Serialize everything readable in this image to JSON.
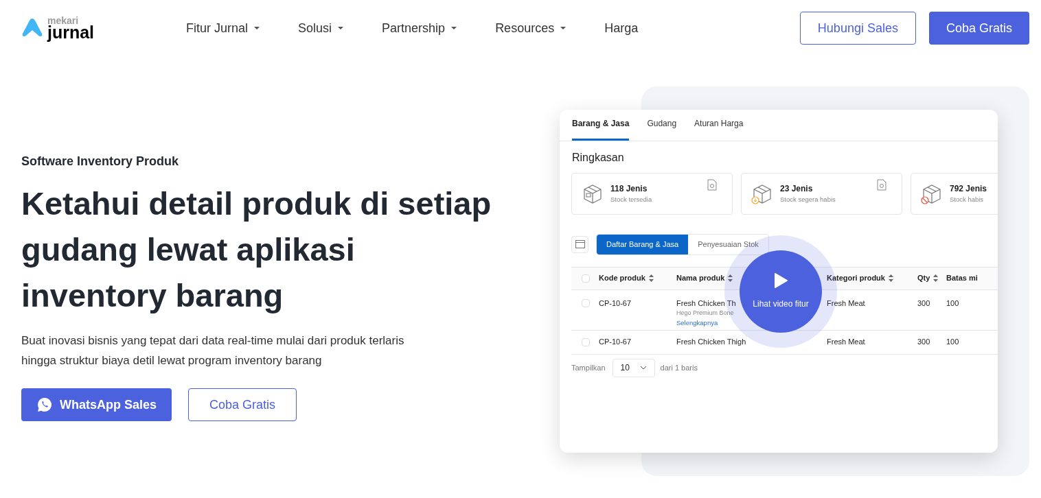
{
  "logo": {
    "brand": "mekari",
    "product": "jurnal"
  },
  "nav": [
    {
      "label": "Fitur Jurnal",
      "has_dropdown": true
    },
    {
      "label": "Solusi",
      "has_dropdown": true
    },
    {
      "label": "Partnership",
      "has_dropdown": true
    },
    {
      "label": "Resources",
      "has_dropdown": true
    },
    {
      "label": "Harga",
      "has_dropdown": false
    }
  ],
  "header_buttons": [
    {
      "label": "Hubungi Sales",
      "kind": "outline"
    },
    {
      "label": "Coba Gratis",
      "kind": "solid"
    }
  ],
  "hero": {
    "eyebrow": "Software Inventory Produk",
    "title_lines": [
      "Ketahui detail produk di setiap",
      "gudang lewat aplikasi",
      "inventory barang"
    ],
    "description_lines": [
      "Buat inovasi bisnis yang tepat dari data real-time mulai dari produk terlaris",
      "hingga struktur biaya detil lewat program inventory barang"
    ],
    "buttons": [
      {
        "label": "WhatsApp Sales",
        "kind": "solid"
      },
      {
        "label": "Coba Gratis",
        "kind": "outline"
      }
    ]
  },
  "mockup": {
    "tabs": [
      {
        "label": "Barang & Jasa",
        "selected": true
      },
      {
        "label": "Gudang",
        "selected": false
      },
      {
        "label": "Aturan Harga",
        "selected": false
      }
    ],
    "summary_title": "Ringkasan",
    "stats": [
      {
        "value": "118 Jenis",
        "label": "Stock tersedia",
        "kind": "available"
      },
      {
        "value": "23 Jenis",
        "label": "Stock segera habis",
        "kind": "low"
      },
      {
        "value": "792 Jenis",
        "label": "Stock habis",
        "kind": "empty"
      }
    ],
    "select_all": {
      "checked": false
    },
    "segments": [
      {
        "label": "Daftar Barang & Jasa",
        "selected": true
      },
      {
        "label": "Penyesuaian Stok",
        "selected": false
      }
    ],
    "columns": [
      "Kode produk",
      "Nama produk",
      "Kategori produk",
      "Qty",
      "Batas mi"
    ],
    "rows": [
      {
        "checked": false,
        "code": "CP-10-67",
        "name": "Fresh Chicken Th",
        "detail": "Hego Premium Bone",
        "link": "Selengkapnya",
        "category": "Fresh Meat",
        "qty": "300",
        "limit": "100"
      },
      {
        "checked": false,
        "code": "CP-10-67",
        "name": "Fresh Chicken Thigh",
        "category": "Fresh Meat",
        "qty": "300",
        "limit": "100"
      }
    ],
    "footer": {
      "show_label": "Tampilkan",
      "page_size": "10",
      "total": "dari 1 baris"
    },
    "video_button": "Lihat video fitur"
  }
}
